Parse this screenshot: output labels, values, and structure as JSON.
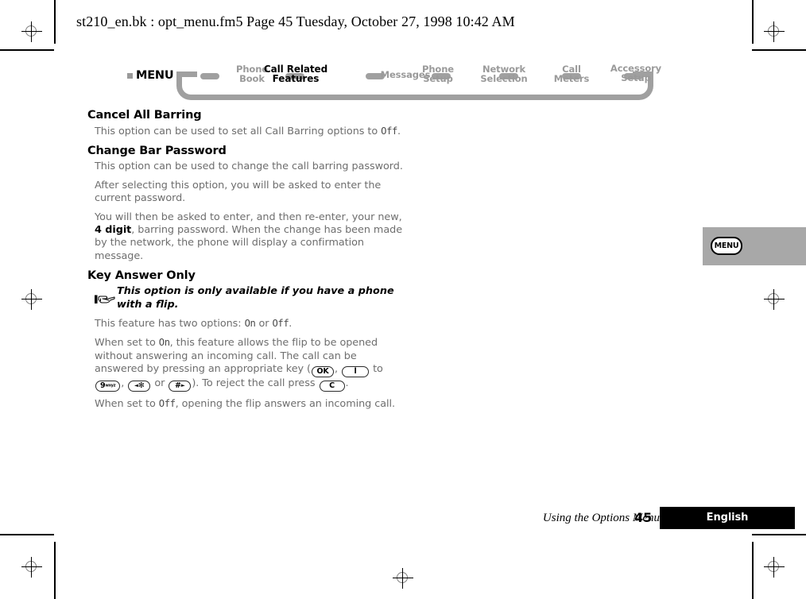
{
  "header": {
    "line": "st210_en.bk : opt_menu.fm5  Page 45  Tuesday, October 27, 1998  10:42 AM"
  },
  "nav": {
    "menu_label": "MENU",
    "items": [
      {
        "line1": "Phone",
        "line2": "Book",
        "current": false
      },
      {
        "line1": "Call Related",
        "line2": "Features",
        "current": true
      },
      {
        "line1": "Messages",
        "line2": "",
        "current": false
      },
      {
        "line1": "Phone",
        "line2": "Setup",
        "current": false
      },
      {
        "line1": "Network",
        "line2": "Selection",
        "current": false
      },
      {
        "line1": "Call",
        "line2": "Meters",
        "current": false
      },
      {
        "line1": "Accessory",
        "line2": "Setup",
        "current": false
      }
    ]
  },
  "content": {
    "heading_1": "Cancel All Barring",
    "para_1_a": "This option can be used to set all Call Barring options to ",
    "para_1_off": "Off",
    "para_1_b": ".",
    "heading_2": "Change Bar Password",
    "para_2": "This option can be used to change the call barring password.",
    "para_3": "After selecting this option, you will be asked to enter the current password.",
    "para_4_a": "You will then be asked to enter, and then re-enter, your new, ",
    "para_4_bold": "4 digit",
    "para_4_b": ", barring password. When the change has been made by the network, the phone will display a confirmation message.",
    "heading_3": "Key Answer Only",
    "note": "This option is only available if you have a phone with a flip.",
    "para_5_a": "This feature has two options: ",
    "para_5_on": "On",
    "para_5_mid": " or ",
    "para_5_off": "Off",
    "para_5_b": ".",
    "para_6_a": "When set to ",
    "para_6_on": "On",
    "para_6_b": ", this feature allows the flip to be opened without answering an incoming call. The call can be answered by pressing an appropriate key (",
    "para_6_c": ", ",
    "para_6_to": " to ",
    "para_6_d": ", ",
    "para_6_or": " or ",
    "para_6_e": "). To reject the call press ",
    "para_6_f": ".",
    "para_7_a": "When set to ",
    "para_7_off": "Off",
    "para_7_b": ", opening the flip answers an incoming call.",
    "keys": {
      "ok": "OK",
      "one": "l",
      "nine": "9",
      "nine_sub": "wxyz",
      "star_arrow": "◄",
      "star": "✻",
      "hash": "#",
      "hash_arrow": "►",
      "clear": "C"
    }
  },
  "sidebar": {
    "tab_key_label": "MENU"
  },
  "footer": {
    "chapter": "Using the Options Menu",
    "page_number": "45",
    "language": "English"
  },
  "colors": {
    "nav_gray": "#a0a0a0",
    "body_gray": "#6e6e6e",
    "sidebar_gray": "#a8a8a8",
    "black": "#000000"
  }
}
